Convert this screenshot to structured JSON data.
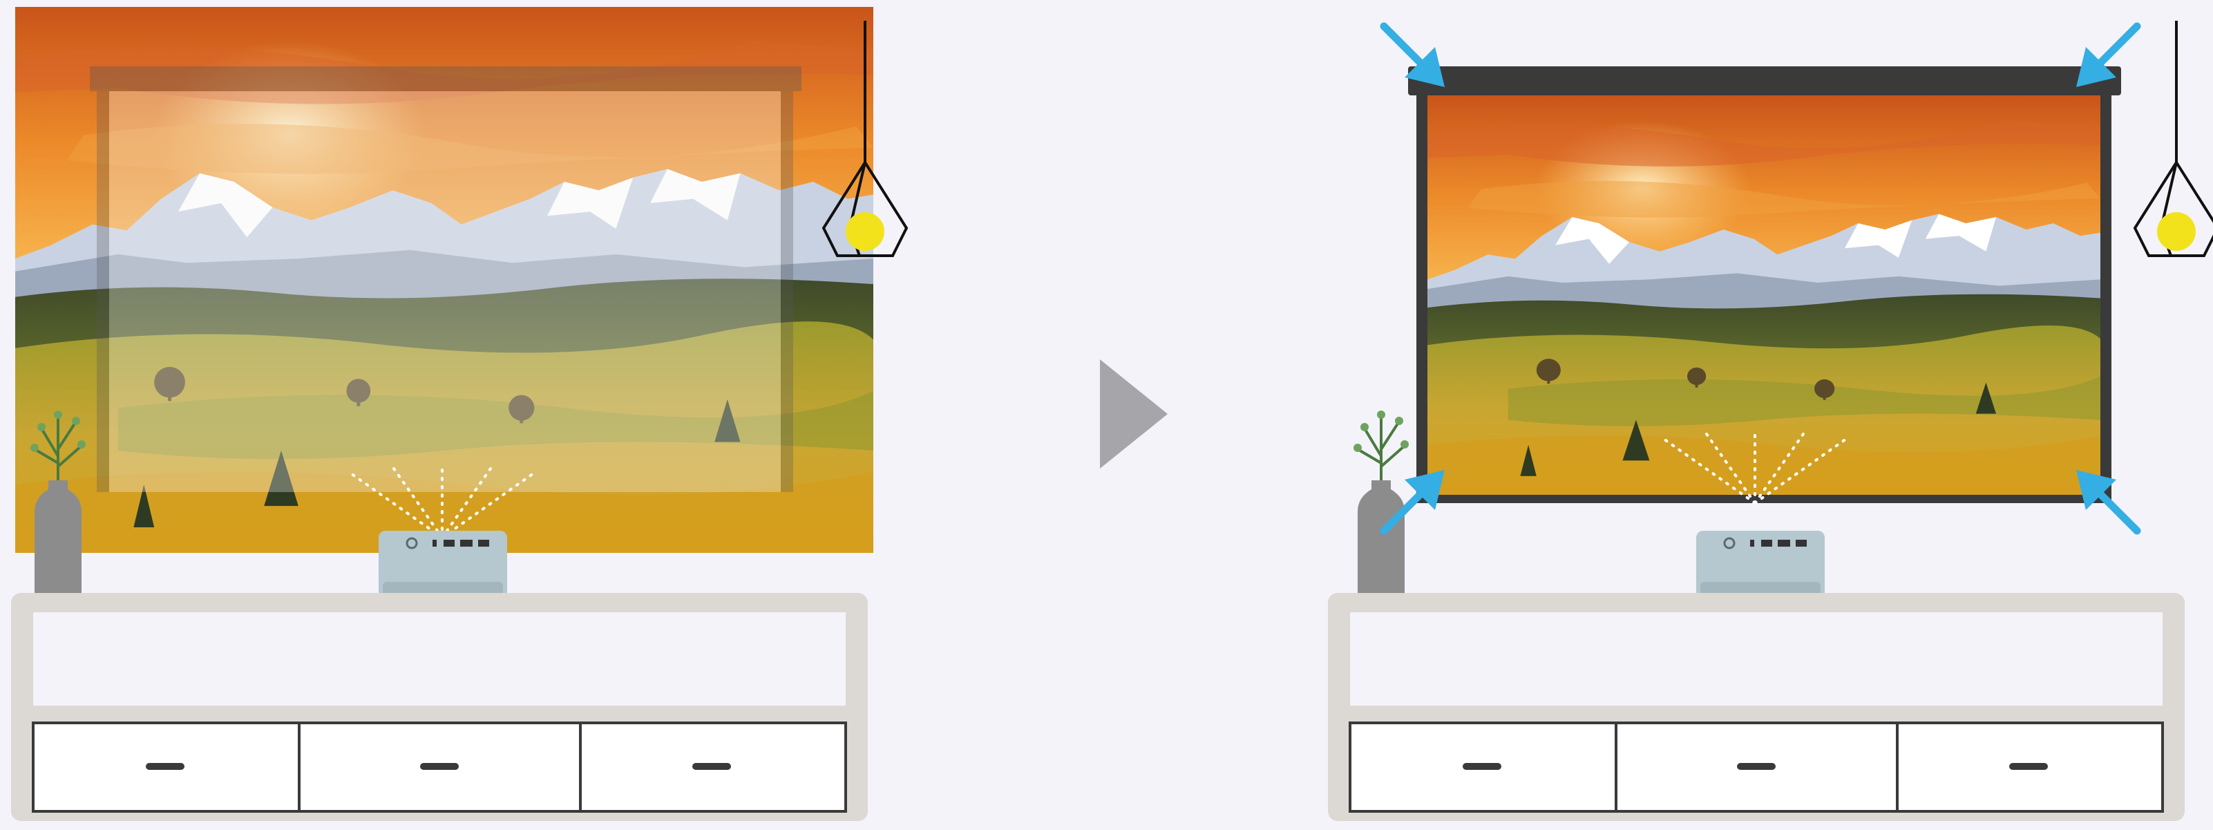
{
  "illustration": {
    "before_panel": {
      "projection_outside_screen": true
    },
    "after_panel": {
      "projection_fits_screen": true
    },
    "transition_arrow_icon": "play-triangle-icon",
    "corner_arrow_icon": "inward-arrow-icon",
    "corner_arrow_count": 4,
    "colors": {
      "background": "#f3f3f9",
      "arrow_blue": "#35aee3",
      "screen_frame": "#3a3a3a",
      "cabinet": "#dcd9d4",
      "projector": "#b5c7cf",
      "lamp_bulb": "#f2e21c",
      "vase": "#8c8c8c",
      "transition_arrow": "#a5a5aa"
    }
  }
}
